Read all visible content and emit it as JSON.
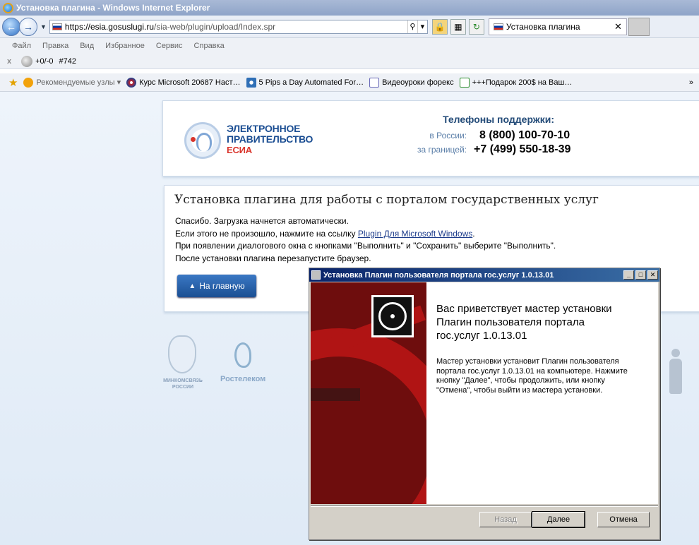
{
  "window": {
    "title": "Установка плагина - Windows Internet Explorer"
  },
  "address": {
    "scheme": "https://",
    "host": "esia.gosuslugi.ru",
    "path": "/sia-web/plugin/upload/Index.spr"
  },
  "tab": {
    "title": "Установка плагина",
    "close": "✕"
  },
  "menu": [
    "Файл",
    "Правка",
    "Вид",
    "Избранное",
    "Сервис",
    "Справка"
  ],
  "command_bar": {
    "close": "x",
    "counter": "+0/-0",
    "id": "#742"
  },
  "favorites": {
    "items": [
      {
        "label": "Рекомендуемые узлы ▾",
        "icon": "orange-feed-icon",
        "color": "#f2a20b"
      },
      {
        "label": "Курс Microsoft 20687 Наст…",
        "icon": "globe-icon",
        "color": "#c4252b"
      },
      {
        "label": "5 Pips a Day Automated For…",
        "icon": "page-icon",
        "color": "#2f6fb6"
      },
      {
        "label": "Видеоуроки форекс",
        "icon": "page-blank-icon",
        "color": "#6b6bb8"
      },
      {
        "label": "+++Подарок 200$ на Ваш…",
        "icon": "ie-page-icon",
        "color": "#2f8f2f"
      }
    ],
    "more": "»"
  },
  "header": {
    "logo_line1": "ЭЛЕКТРОННОЕ",
    "logo_line2": "ПРАВИТЕЛЬСТВО",
    "logo_line3": "ЕСИА",
    "phones_title": "Телефоны поддержки:",
    "russia_label": "в России:",
    "russia_number": "8 (800) 100-70-10",
    "abroad_label": "за границей:",
    "abroad_number": "+7 (499) 550-18-39"
  },
  "content": {
    "heading": "Установка плагина для работы с порталом государственных услуг",
    "line1": "Спасибо. Загрузка начнется автоматически.",
    "line2_prefix": "Если этого не произошло, нажмите на ссылку ",
    "line2_link": "Plugin Для Microsoft Windows",
    "line2_suffix": ".",
    "line3": "При появлении диалогового окна с кнопками \"Выполнить\" и \"Сохранить\" выберите \"Выполнить\".",
    "line4": "После установки плагина перезапустите браузер.",
    "home_button": "На главную"
  },
  "partners": {
    "minsvyaz_line1": "МИНКОМСВЯЗЬ",
    "minsvyaz_line2": "РОССИИ",
    "rostelecom": "Ростелеком"
  },
  "dialog": {
    "title": "Установка Плагин пользователя портала гос.услуг 1.0.13.01",
    "welcome_line1": "Вас приветствует мастер установки",
    "welcome_line2": "Плагин пользователя портала",
    "welcome_line3": "гос.услуг 1.0.13.01",
    "desc_line1": "Мастер установки установит Плагин пользователя",
    "desc_line2": "портала гос.услуг 1.0.13.01 на компьютере. Нажмите",
    "desc_line3": "кнопку \"Далее\", чтобы продолжить, или кнопку",
    "desc_line4": "\"Отмена\", чтобы выйти из мастера установки.",
    "back_button": "Назад",
    "next_button": "Далее",
    "cancel_button": "Отмена"
  }
}
